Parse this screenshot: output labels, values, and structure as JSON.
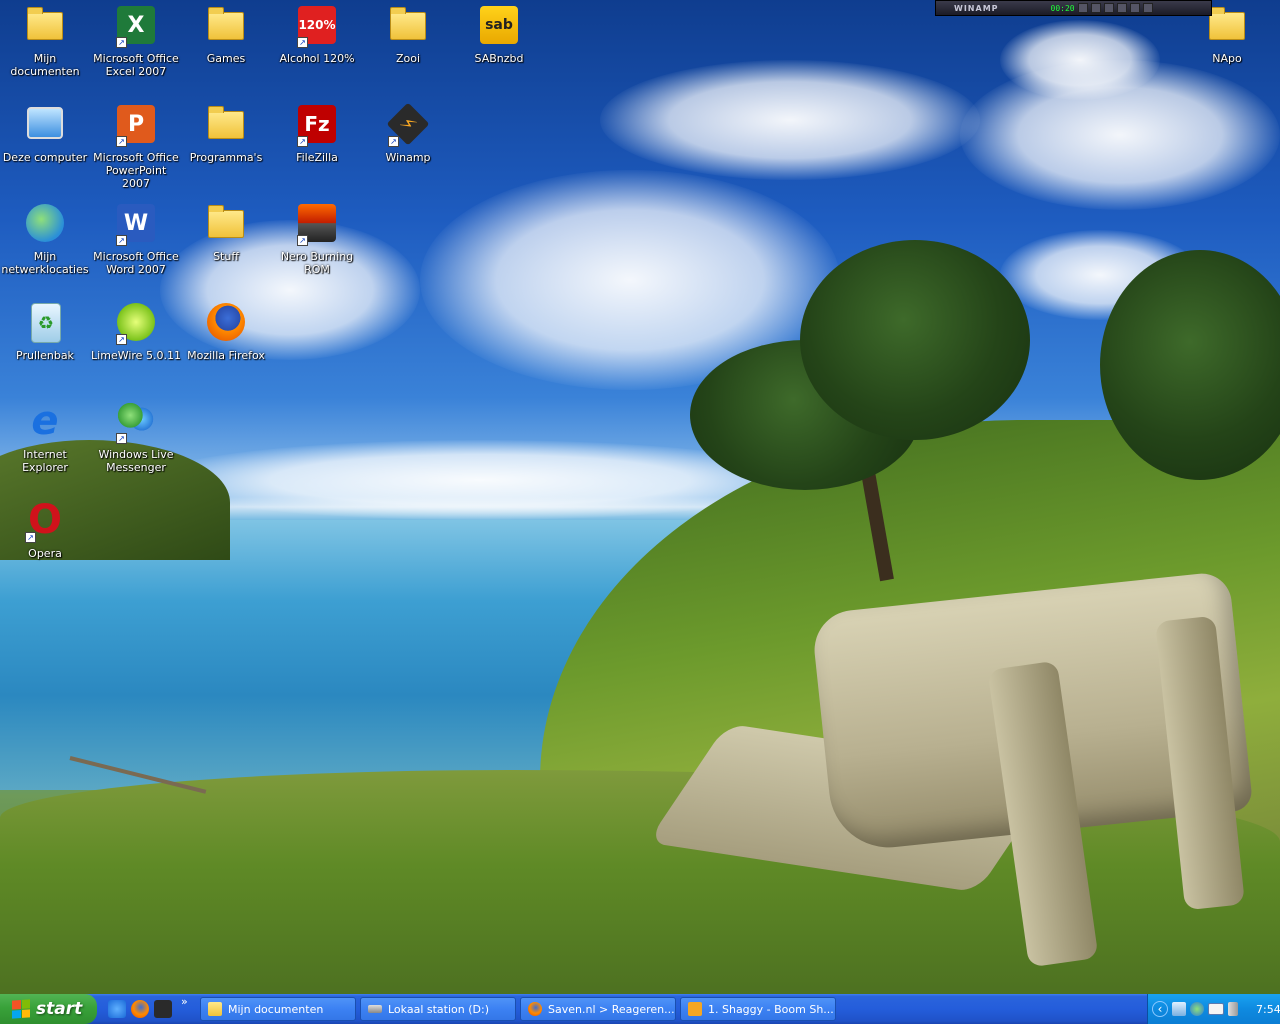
{
  "desktop_icons": [
    {
      "label": "Mijn documenten",
      "icon": "my-documents-icon"
    },
    {
      "label": "Microsoft Office\nExcel 2007",
      "icon": "excel-icon"
    },
    {
      "label": "Games",
      "icon": "folder-icon"
    },
    {
      "label": "Alcohol 120%",
      "icon": "alcohol-120-icon"
    },
    {
      "label": "Zooi",
      "icon": "folder-icon"
    },
    {
      "label": "SABnzbd",
      "icon": "sabnzbd-icon"
    },
    {
      "label": "Deze computer",
      "icon": "my-computer-icon"
    },
    {
      "label": "Microsoft Office\nPowerPoint 2007",
      "icon": "powerpoint-icon"
    },
    {
      "label": "Programma's",
      "icon": "folder-icon"
    },
    {
      "label": "FileZilla",
      "icon": "filezilla-icon"
    },
    {
      "label": "Winamp",
      "icon": "winamp-icon"
    },
    {
      "label": "Mijn\nnetwerklocaties",
      "icon": "network-places-icon"
    },
    {
      "label": "Microsoft Office\nWord 2007",
      "icon": "word-icon"
    },
    {
      "label": "Stuff",
      "icon": "folder-icon"
    },
    {
      "label": "Nero Burning\nROM",
      "icon": "nero-icon"
    },
    {
      "label": "Prullenbak",
      "icon": "recycle-bin-icon"
    },
    {
      "label": "LimeWire 5.0.11",
      "icon": "limewire-icon"
    },
    {
      "label": "Mozilla Firefox",
      "icon": "firefox-icon"
    },
    {
      "label": "Internet Explorer",
      "icon": "internet-explorer-icon"
    },
    {
      "label": "Windows Live\nMessenger",
      "icon": "messenger-icon"
    },
    {
      "label": "Opera",
      "icon": "opera-icon"
    },
    {
      "label": "NApo",
      "icon": "folder-icon"
    }
  ],
  "winamp": {
    "title": "WINAMP",
    "time": "00:20"
  },
  "taskbar": {
    "start_label": "start",
    "quick_launch": [
      "internet-explorer-icon",
      "firefox-icon",
      "winamp-icon"
    ],
    "overflow": "»",
    "tasks": [
      {
        "label": "Mijn documenten",
        "icon": "folder-icon"
      },
      {
        "label": "Lokaal station (D:)",
        "icon": "drive-icon"
      },
      {
        "label": "Saven.nl > Reageren...",
        "icon": "firefox-icon"
      },
      {
        "label": "1. Shaggy - Boom Sh...",
        "icon": "winamp-icon"
      }
    ],
    "tray_icons": [
      "chevron-left-icon",
      "network-icon",
      "messenger-icon",
      "mail-icon",
      "volume-icon"
    ],
    "clock": "7:54"
  }
}
